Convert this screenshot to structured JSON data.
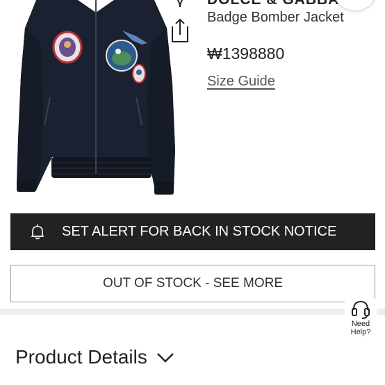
{
  "product": {
    "brand": "DOLCE & GABBANA",
    "title": "Badge Bomber Jacket",
    "price": "₩1398880",
    "size_guide_label": "Size Guide"
  },
  "actions": {
    "alert_label": "SET ALERT FOR BACK IN STOCK NOTICE",
    "out_of_stock_label": "OUT OF STOCK - SEE MORE"
  },
  "help": {
    "line1": "Need",
    "line2": "Help?"
  },
  "details": {
    "label": "Product Details"
  },
  "icons": {
    "wishlist": "heart-icon",
    "share": "share-icon",
    "alert": "bell-icon",
    "help": "headset-icon",
    "expand": "chevron-down-icon"
  },
  "colors": {
    "primary_button": "#222222",
    "jacket": "#1b2130"
  }
}
